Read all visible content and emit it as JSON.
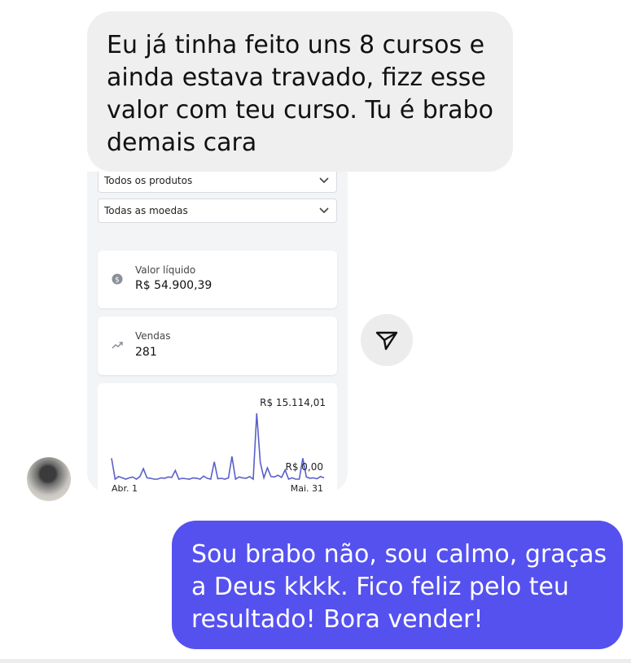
{
  "messages": {
    "received": {
      "lines": [
        "Eu já tinha feito uns 8 cursos e",
        "ainda estava travado, fizz esse",
        "valor com teu curso. Tu é brabo",
        "demais cara"
      ]
    },
    "sent": {
      "lines": [
        "Sou brabo não, sou calmo, graças",
        "a Deus kkkk. Fico feliz pelo teu",
        "resultado! Bora vender!"
      ]
    }
  },
  "screenshot": {
    "product_filter": "Todos os produtos",
    "currency_filter": "Todas as moedas",
    "net_value": {
      "label": "Valor líquido",
      "value": "R$ 54.900,39",
      "icon": "dollar-coin-icon"
    },
    "sales": {
      "label": "Vendas",
      "value": "281",
      "icon": "trending-up-icon"
    },
    "chart_labels": {
      "max": "R$ 15.114,01",
      "min": "R$ 0,00",
      "x_start": "Abr. 1",
      "x_end": "Mai. 31"
    }
  },
  "chart_data": {
    "type": "line",
    "series": [
      {
        "values": [
          4800,
          0,
          600,
          300,
          0,
          300,
          500,
          0,
          600,
          2400,
          300,
          200,
          0,
          0,
          300,
          200,
          500,
          400,
          2000,
          0,
          200,
          100,
          0,
          300,
          200,
          0,
          700,
          200,
          0,
          4000,
          100,
          200,
          0,
          300,
          5200,
          0,
          500,
          300,
          200,
          600,
          0,
          15114.01,
          3800,
          300,
          2600,
          600,
          500,
          900,
          400,
          2100,
          0,
          300,
          0,
          0,
          4800,
          500,
          200,
          300,
          100,
          600,
          300
        ]
      }
    ],
    "ylim": [
      0,
      15114.01
    ],
    "x_range": [
      "Abr. 1",
      "Mai. 31"
    ],
    "colors": {
      "line": "#5a5fc9"
    }
  },
  "ui": {
    "send_icon": "send-icon",
    "accent_color": "#5551ef"
  }
}
